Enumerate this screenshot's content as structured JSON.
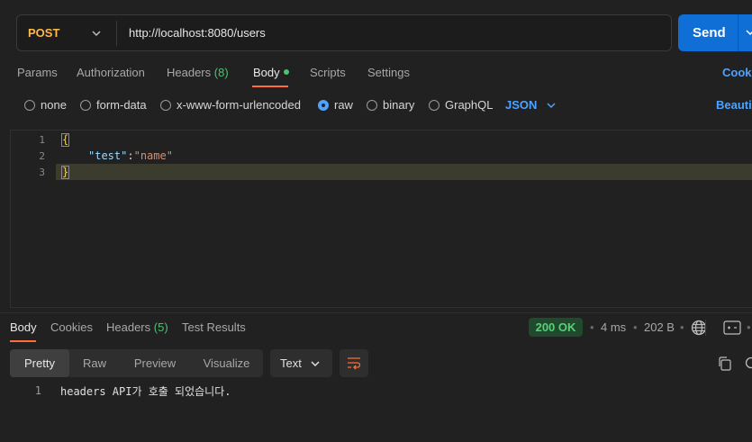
{
  "request": {
    "method": "POST",
    "url": "http://localhost:8080/users",
    "send_label": "Send"
  },
  "request_tabs": {
    "params": "Params",
    "authorization": "Authorization",
    "headers": "Headers",
    "headers_count": "(8)",
    "body": "Body",
    "scripts": "Scripts",
    "settings": "Settings",
    "cookies": "Cookies"
  },
  "body_types": {
    "none": "none",
    "form_data": "form-data",
    "urlencoded": "x-www-form-urlencoded",
    "raw": "raw",
    "binary": "binary",
    "graphql": "GraphQL",
    "selected": "raw",
    "format": "JSON",
    "beautify": "Beautify"
  },
  "editor": {
    "line_numbers": [
      "1",
      "2",
      "3"
    ],
    "open_brace": "{",
    "key": "\"test\"",
    "colon": ":",
    "value": "\"name\"",
    "close_brace": "}"
  },
  "response": {
    "tabs": {
      "body": "Body",
      "cookies": "Cookies",
      "headers": "Headers",
      "headers_count": "(5)",
      "test_results": "Test Results"
    },
    "status": "200 OK",
    "time": "4 ms",
    "size": "202 B",
    "view_modes": [
      "Pretty",
      "Raw",
      "Preview",
      "Visualize"
    ],
    "active_view": "Pretty",
    "content_type": "Text",
    "line_number": "1",
    "content": "headers API가 호출 되었습니다."
  },
  "colors": {
    "method": "#ffb84d",
    "send": "#0f6fd6",
    "accent_link": "#4da3ff",
    "status_ok": "#58d07a",
    "tab_underline": "#ff6c37"
  }
}
